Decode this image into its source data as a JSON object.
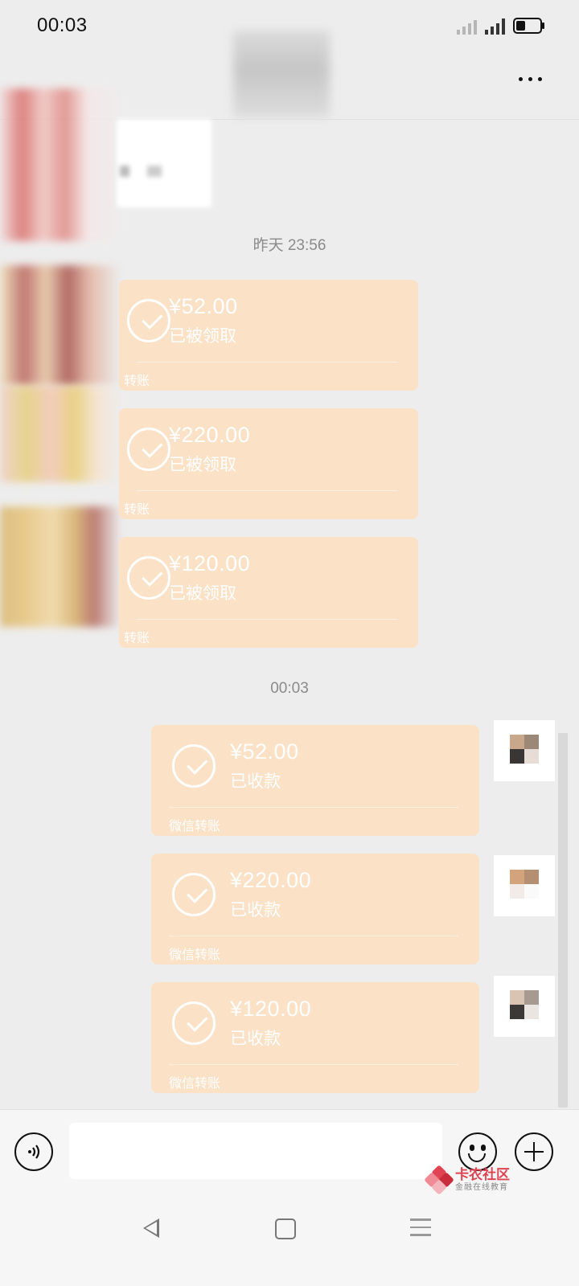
{
  "status_bar": {
    "time": "00:03",
    "battery_percent": 40
  },
  "timestamps": {
    "yesterday": "昨天 23:56",
    "now": "00:03"
  },
  "incoming_transfers": [
    {
      "amount": "¥52.00",
      "status": "已被领取",
      "source": "转账"
    },
    {
      "amount": "¥220.00",
      "status": "已被领取",
      "source": "转账"
    },
    {
      "amount": "¥120.00",
      "status": "已被领取",
      "source": "转账"
    }
  ],
  "outgoing_transfers": [
    {
      "amount": "¥52.00",
      "status": "已收款",
      "source": "微信转账"
    },
    {
      "amount": "¥220.00",
      "status": "已收款",
      "source": "微信转账"
    },
    {
      "amount": "¥120.00",
      "status": "已收款",
      "source": "微信转账"
    }
  ],
  "input": {
    "value": "",
    "placeholder": ""
  },
  "icons": {
    "more": "more-dots-icon",
    "voice": "voice-icon",
    "emoji": "emoji-icon",
    "plus": "plus-icon",
    "back": "nav-back-icon",
    "home": "nav-home-icon",
    "menu": "nav-menu-icon",
    "check": "check-circle-icon"
  },
  "colors": {
    "transfer_card": "#fbe1c6",
    "background": "#ededed",
    "watermark": "#e04452"
  },
  "watermark": {
    "title": "卡农社区",
    "subtitle": "金融在线教育"
  }
}
